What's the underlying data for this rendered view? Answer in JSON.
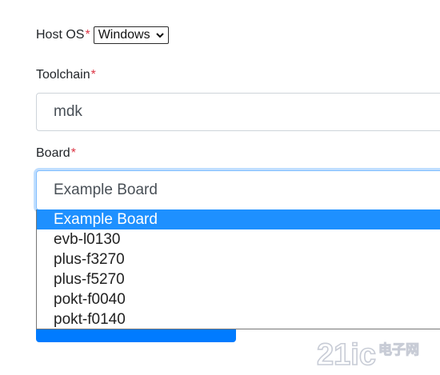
{
  "host_os": {
    "label": "Host OS",
    "required_mark": "*",
    "selected": "Windows"
  },
  "toolchain": {
    "label": "Toolchain",
    "required_mark": "*",
    "value": "mdk"
  },
  "board": {
    "label": "Board",
    "required_mark": "*",
    "value": "Example Board",
    "options": [
      "Example Board",
      "evb-l0130",
      "plus-f3270",
      "plus-f5270",
      "pokt-f0040",
      "pokt-f0140"
    ],
    "selected_index": 0
  },
  "watermark": {
    "brand": "21ic",
    "cn_text": "电子网"
  },
  "colors": {
    "accent": "#007bff",
    "required": "#dc3545",
    "focus_border": "#80bdff",
    "option_highlight": "#1e90ff"
  }
}
